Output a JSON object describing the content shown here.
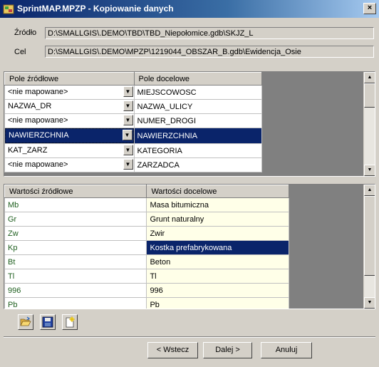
{
  "window": {
    "title": "SprintMAP.MPZP - Kopiowanie danych",
    "close_glyph": "×"
  },
  "paths": {
    "source_label": "Źródło",
    "source_value": "D:\\SMALLGIS\\.DEMO\\TBD\\TBD_Niepołomice.gdb\\SKJZ_L",
    "target_label": "Cel",
    "target_value": "D:\\SMALLGIS\\.DEMO\\MPZP\\1219044_OBSZAR_B.gdb\\Ewidencja_Osie"
  },
  "field_map": {
    "headers": [
      "Pole źródłowe",
      "Pole docelowe"
    ],
    "rows": [
      {
        "source": "<nie mapowane>",
        "target": "MIEJSCOWOSC",
        "selected": false
      },
      {
        "source": "NAZWA_DR",
        "target": "NAZWA_ULICY",
        "selected": false
      },
      {
        "source": "<nie mapowane>",
        "target": "NUMER_DROGI",
        "selected": false
      },
      {
        "source": "NAWIERZCHNIA",
        "target": "NAWIERZCHNIA",
        "selected": true
      },
      {
        "source": "KAT_ZARZ",
        "target": "KATEGORIA",
        "selected": false
      },
      {
        "source": "<nie mapowane>",
        "target": "ZARZADCA",
        "selected": false
      }
    ]
  },
  "value_map": {
    "headers": [
      "Wartości źródłowe",
      "Wartości docelowe"
    ],
    "rows": [
      {
        "source": "Mb",
        "target": "Masa bitumiczna",
        "selected": false
      },
      {
        "source": "Gr",
        "target": "Grunt naturalny",
        "selected": false
      },
      {
        "source": "Zw",
        "target": "Zwir",
        "selected": false
      },
      {
        "source": "Kp",
        "target": "Kostka prefabrykowana",
        "selected": true
      },
      {
        "source": "Bt",
        "target": "Beton",
        "selected": false
      },
      {
        "source": "Tl",
        "target": "Tl",
        "selected": false
      },
      {
        "source": "996",
        "target": "996",
        "selected": false
      },
      {
        "source": "Pb",
        "target": "Pb",
        "selected": false
      }
    ]
  },
  "toolbar": {
    "icons": [
      "open-folder-icon",
      "save-icon",
      "new-file-icon"
    ]
  },
  "buttons": {
    "back": "< Wstecz",
    "next": "Dalej >",
    "cancel": "Anuluj"
  }
}
